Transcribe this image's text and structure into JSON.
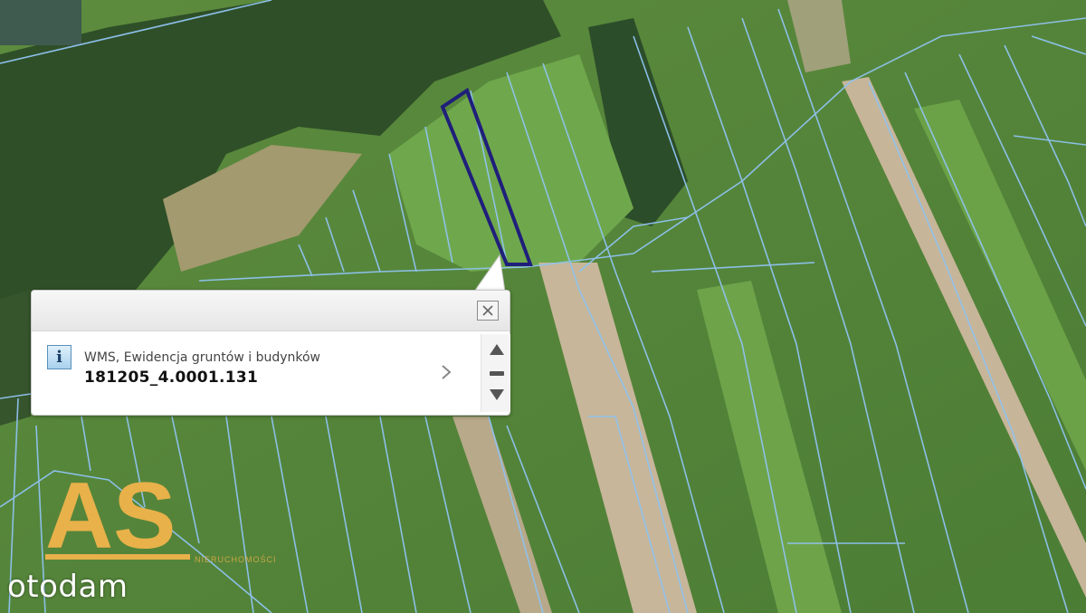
{
  "map": {
    "parcel_line_color": "#8fc3f0",
    "selected_parcel_color": "#1f1f7a"
  },
  "popup": {
    "close_icon": "close-icon",
    "info_icon": "info-icon",
    "info_glyph": "i",
    "layer_name": "WMS, Ewidencja gruntów i budynków",
    "parcel_id": "181205_4.0001.131",
    "detail_icon": "chevron-right-icon",
    "scroll_up_icon": "triangle-up-icon",
    "scroll_mid_icon": "dash-icon",
    "scroll_down_icon": "triangle-down-icon"
  },
  "watermark": {
    "logo_text": "AS",
    "logo_subtext": "NIERUCHOMOŚCI",
    "brand": "otodam",
    "logo_color": "#e8b14a"
  }
}
